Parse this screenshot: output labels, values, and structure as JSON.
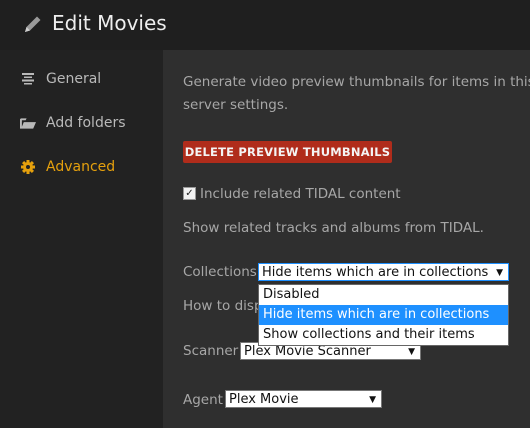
{
  "header": {
    "title": "Edit Movies"
  },
  "sidebar": {
    "items": [
      {
        "label": "General",
        "icon": "list-icon"
      },
      {
        "label": "Add folders",
        "icon": "folder-icon"
      },
      {
        "label": "Advanced",
        "icon": "gear-icon",
        "active": true
      }
    ]
  },
  "main": {
    "preview_text_line1": "Generate video preview thumbnails for items in this li",
    "preview_text_line2": "server settings.",
    "delete_button": "DELETE PREVIEW THUMBNAILS",
    "tidal_checkbox_label": "Include related TIDAL content",
    "tidal_checked": true,
    "tidal_description": "Show related tracks and albums from TIDAL.",
    "collections_label": "Collections",
    "collections_value": "Hide items which are in collections",
    "collections_options": [
      "Disabled",
      "Hide items which are in collections",
      "Show collections and their items"
    ],
    "how_to_display_label": "How to disp",
    "scanner_label": "Scanner",
    "scanner_value": "Plex Movie Scanner",
    "agent_label": "Agent",
    "agent_value": "Plex Movie"
  },
  "colors": {
    "accent": "#e5a00d",
    "danger": "#b02c1b",
    "selection": "#1e90ff"
  }
}
